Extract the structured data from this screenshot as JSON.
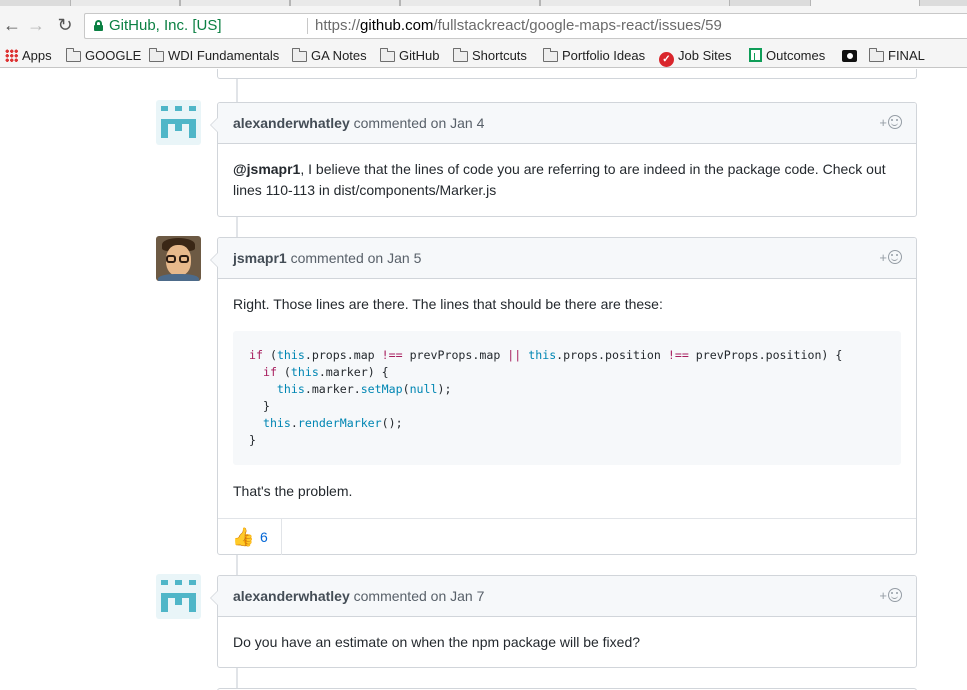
{
  "browser": {
    "organization": "GitHub, Inc. [US]",
    "url_scheme": "https://",
    "url_host": "github.com",
    "url_path": "/fullstackreact/google-maps-react/issues/59",
    "nav": {
      "back_icon": "back-arrow-icon",
      "forward_icon": "forward-arrow-icon",
      "reload_icon": "reload-icon"
    }
  },
  "bookmarks": [
    {
      "label": "Apps",
      "icon": "apps-grid-icon"
    },
    {
      "label": "GOOGLE",
      "icon": "folder-icon"
    },
    {
      "label": "WDI Fundamentals",
      "icon": "folder-icon"
    },
    {
      "label": "GA Notes",
      "icon": "folder-icon"
    },
    {
      "label": "GitHub",
      "icon": "folder-icon"
    },
    {
      "label": "Shortcuts",
      "icon": "folder-icon"
    },
    {
      "label": "Portfolio Ideas",
      "icon": "folder-icon"
    },
    {
      "label": "Job Sites",
      "icon": "job-sites-icon"
    },
    {
      "label": "Outcomes",
      "icon": "sheets-icon"
    },
    {
      "label": "",
      "icon": "camera-icon"
    },
    {
      "label": "FINAL",
      "icon": "folder-icon"
    }
  ],
  "comments": [
    {
      "author": "alexanderwhatley",
      "action": "commented",
      "date": "on Jan 4",
      "mention": "@jsmapr1",
      "body_after_mention": ", I believe that the lines of code you are referring to are indeed in the package code. Check out lines 110-113 in dist/components/Marker.js"
    },
    {
      "author": "jsmapr1",
      "action": "commented",
      "date": "on Jan 5",
      "intro": "Right. Those lines are there. The lines that should be there are these:",
      "code": [
        "if (this.props.map !== prevProps.map || this.props.position !== prevProps.position) {",
        "  if (this.marker) {",
        "    this.marker.setMap(null);",
        "  }",
        "  this.renderMarker();",
        "}"
      ],
      "outro": "That's the problem.",
      "reaction": {
        "emoji": "👍",
        "count": "6"
      }
    },
    {
      "author": "alexanderwhatley",
      "action": "commented",
      "date": "on Jan 7",
      "body": "Do you have an estimate on when the npm package will be fixed?"
    }
  ],
  "reaction_add_label": "+"
}
